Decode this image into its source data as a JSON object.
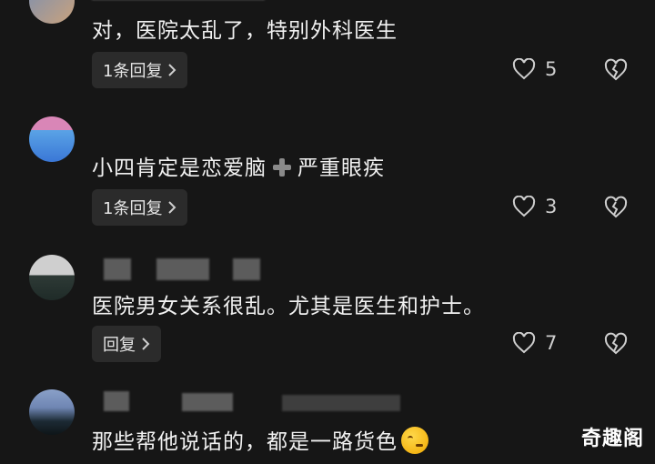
{
  "comments": [
    {
      "text": "对，医院太乱了，特别外科医生",
      "reply_label": "1条回复",
      "likes": "5"
    },
    {
      "text_before": "小四肯定是恋爱脑",
      "text_after": "严重眼疾",
      "reply_label": "1条回复",
      "likes": "3"
    },
    {
      "text": "医院男女关系很乱。尤其是医生和护士。",
      "reply_label": "回复",
      "likes": "7"
    },
    {
      "text": "那些帮他说话的，都是一路货色"
    }
  ],
  "watermark": "奇趣阁",
  "icons": {
    "like": "heart-outline-icon",
    "dislike": "broken-heart-icon",
    "chevron": "chevron-right-icon",
    "plus": "plus-emoji-icon",
    "emoji": "smirk-emoji-icon"
  }
}
